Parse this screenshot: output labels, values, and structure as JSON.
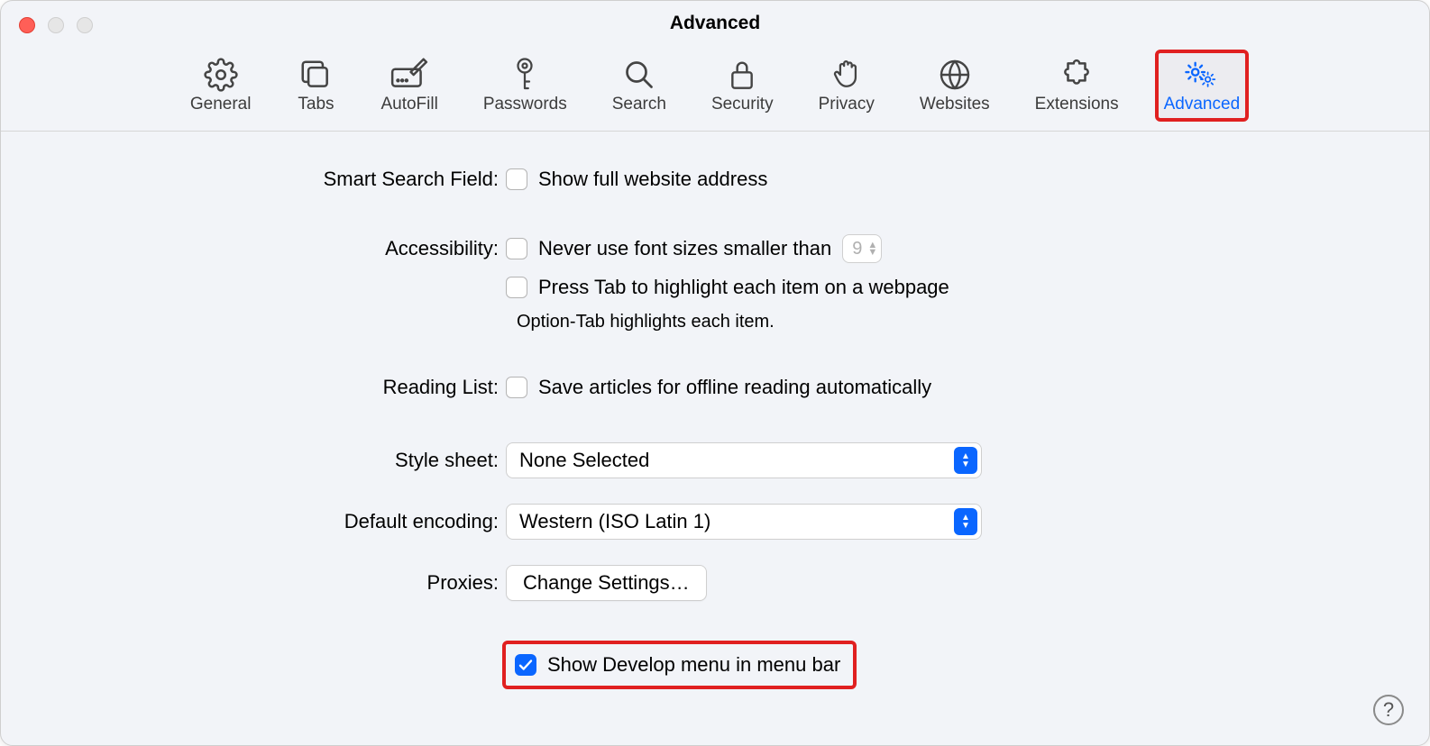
{
  "window": {
    "title": "Advanced"
  },
  "toolbar": {
    "items": [
      {
        "id": "general",
        "label": "General"
      },
      {
        "id": "tabs",
        "label": "Tabs"
      },
      {
        "id": "autofill",
        "label": "AutoFill"
      },
      {
        "id": "passwords",
        "label": "Passwords"
      },
      {
        "id": "search",
        "label": "Search"
      },
      {
        "id": "security",
        "label": "Security"
      },
      {
        "id": "privacy",
        "label": "Privacy"
      },
      {
        "id": "websites",
        "label": "Websites"
      },
      {
        "id": "extensions",
        "label": "Extensions"
      },
      {
        "id": "advanced",
        "label": "Advanced",
        "active": true,
        "highlighted": true
      }
    ]
  },
  "sections": {
    "smart_search": {
      "label": "Smart Search Field:",
      "show_full_address": {
        "checked": false,
        "text": "Show full website address"
      }
    },
    "accessibility": {
      "label": "Accessibility:",
      "min_font": {
        "checked": false,
        "text": "Never use font sizes smaller than",
        "value": "9"
      },
      "press_tab": {
        "checked": false,
        "text": "Press Tab to highlight each item on a webpage"
      },
      "hint": "Option-Tab highlights each item."
    },
    "reading_list": {
      "label": "Reading List:",
      "offline": {
        "checked": false,
        "text": "Save articles for offline reading automatically"
      }
    },
    "style_sheet": {
      "label": "Style sheet:",
      "value": "None Selected"
    },
    "default_encoding": {
      "label": "Default encoding:",
      "value": "Western (ISO Latin 1)"
    },
    "proxies": {
      "label": "Proxies:",
      "button": "Change Settings…"
    },
    "develop": {
      "checked": true,
      "text": "Show Develop menu in menu bar"
    }
  },
  "help_button": "?"
}
